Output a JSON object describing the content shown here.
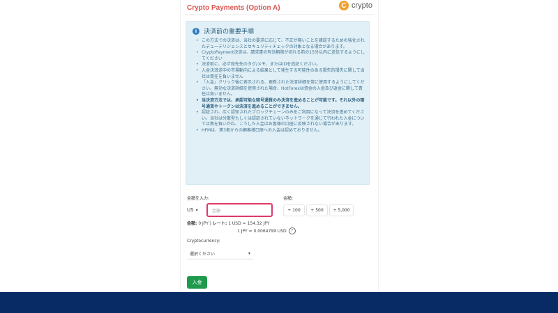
{
  "header": {
    "title": "Crypto Payments (Option A)",
    "brand_text": "crypto",
    "brand_badge": "C"
  },
  "notice": {
    "title": "決済前の重要手順",
    "items": [
      {
        "text": "この方法での決済は、当社の要求に応じて、不正が無いことを確認するための強化されたデューデリジェンスとセキュリティチェックの対象となる場合があります。",
        "bold": false
      },
      {
        "text": "CryptoPayment決済は、請求書の有効期限が切れる前の15分以内に送信するようにしてください",
        "bold": false
      },
      {
        "text": "決済前に、必ず宛先先のタグ/メモ、またはIDを追記ください。",
        "bold": false
      },
      {
        "text": "入金決済送中の市場動向による結果として発生する可能性のある損失的損失に関して当社は責任を負いません",
        "bold": false
      },
      {
        "text": "「入金」クリック後に表示される、更新された決済詳細を常に使用するようにしてください。無効な決済詳細を使用された場合、HotForexは資金の入金及び返金に関して責任は負いません。",
        "bold": false
      },
      {
        "text": "当決済方法では、承認可能な暗号通貨のみ決済を進めることが可能です。それ以外の暗号通貨やトークンは決済を進めることができません。",
        "bold": true
      },
      {
        "text": "認証され、広く認知されたブロックチェーンのみをご利用になって決済を進めてください。当社は分散型もしくは認証されていないネットワークを通じて行われた入金については責を負いかね、こうした入金はお客様の口座に反映されない場合があります。",
        "bold": false
      },
      {
        "text": "HFMは、第3者からの顧客様口座への入金は認めておりません。",
        "bold": false
      }
    ]
  },
  "form": {
    "amount_label": "金額を入力:",
    "currency_value": "US",
    "amount_placeholder": "金額",
    "quick_label": "金額:",
    "quick_amounts": [
      "+ 100",
      "+ 500",
      "+ 5,000"
    ],
    "summary_amount_label": "金額:",
    "summary_amount_value": "0 JPY",
    "summary_rate_label": "レート:",
    "summary_rate_value": "1 USD = 154.32 JPY",
    "summary_rate_inverse": "1 JPY = 0.0064799 USD",
    "help_glyph": "?",
    "crypto_label": "Cryptocurrency:",
    "crypto_value": "選択ください",
    "submit_label": "入金"
  },
  "colors": {
    "accent_red": "#d9534f",
    "input_border": "#e0386a",
    "submit_green": "#1f9a4d",
    "footer_navy": "#082a65"
  }
}
